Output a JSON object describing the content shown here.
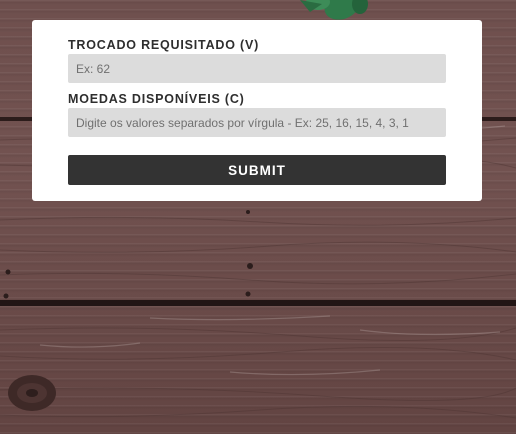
{
  "form": {
    "change_label": "TROCADO REQUISITADO (V)",
    "change_placeholder": "Ex: 62",
    "coins_label": "MOEDAS DISPONÍVEIS (C)",
    "coins_placeholder": "Digite os valores separados por vírgula - Ex: 25, 16, 15, 4, 3, 1",
    "submit_label": "SUBMIT"
  },
  "background": {
    "wood_color": "#6b4c4a",
    "leaf_color": "#2f7a4a"
  },
  "colors": {
    "card": "#ffffff",
    "input_bg": "#dcdcdc",
    "button_bg": "#333333"
  }
}
